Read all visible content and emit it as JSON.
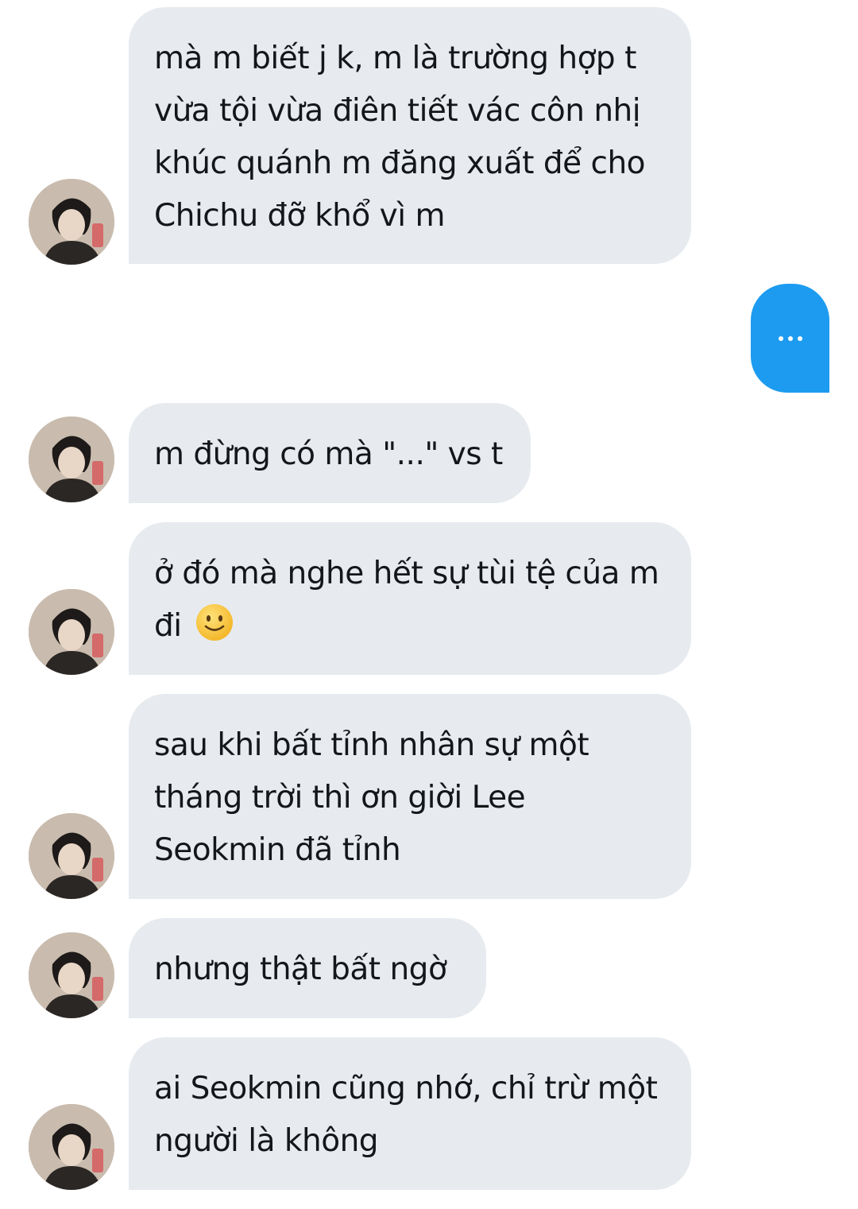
{
  "messages": [
    {
      "text": "mà m biết j k, m là trường hợp t vừa tội vừa điên tiết vác côn nhị khúc quánh m đăng xuất để cho Chichu đỡ khổ vì m"
    },
    {
      "text": "m đừng có mà \"...\" vs t"
    },
    {
      "text": "ở đó mà nghe hết sự tùi tệ của m đi"
    },
    {
      "text": "sau khi bất tỉnh nhân sự một tháng trời thì ơn giời Lee Seokmin đã tỉnh"
    },
    {
      "text": "nhưng thật bất ngờ"
    },
    {
      "text": "ai Seokmin cũng nhớ, chỉ trừ một người là không"
    }
  ],
  "emoji": {
    "name": "slightly-smiling-face-icon"
  },
  "typing_indicator": {
    "icon": "ellipsis-icon"
  },
  "colors": {
    "incoming_bubble": "#e7ebef",
    "outgoing_bubble": "#1d9bf0",
    "text": "#14171a"
  }
}
